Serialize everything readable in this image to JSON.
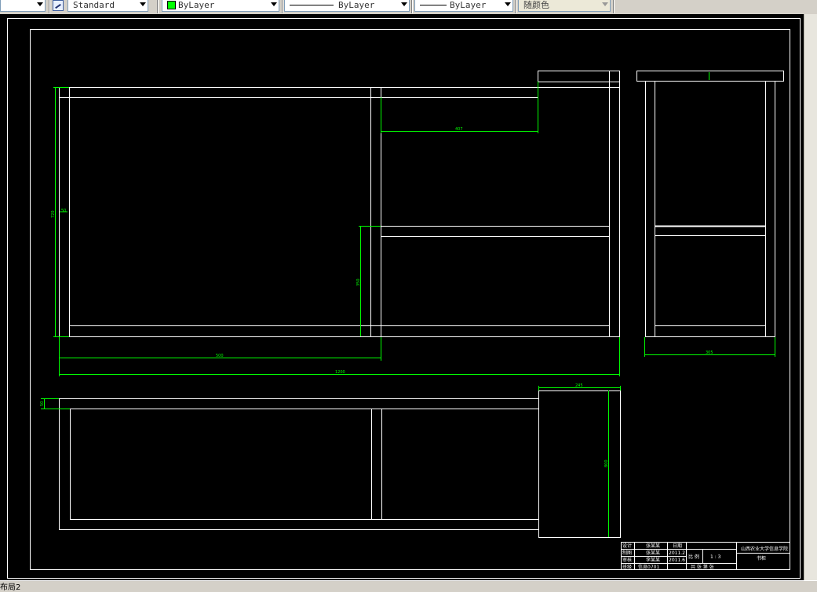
{
  "toolbar": {
    "text_style": "Standard",
    "layer": "ByLayer",
    "linetype": "ByLayer",
    "lineweight": "ByLayer",
    "plot_style": "随颜色",
    "layer_color": "#00ff00"
  },
  "drawing": {
    "dims": {
      "top_span": "407",
      "height_left": "720",
      "small_left": "50",
      "inner_height": "350",
      "left_width": "500",
      "total_width": "1200",
      "side_width": "305",
      "plan_small": "50",
      "plan_top": "245",
      "plan_depth": "800"
    },
    "title_block": {
      "school": "山西农业大学信息学院",
      "drawing_name": "书柜",
      "scale_label": "比 例",
      "scale_value": "1 : 3",
      "sheet_text": "共 张 第 张",
      "rows": [
        {
          "role": "设计",
          "name": "张某某",
          "date_label": "日期"
        },
        {
          "role": "制图",
          "name": "张某某",
          "date_label": "2011.2"
        },
        {
          "role": "审核",
          "name": "李某某",
          "date_label": "2011.6"
        },
        {
          "role": "班级",
          "name": "信息0701",
          "date_label": ""
        }
      ]
    }
  },
  "status": {
    "layout_tab": "布局2"
  }
}
